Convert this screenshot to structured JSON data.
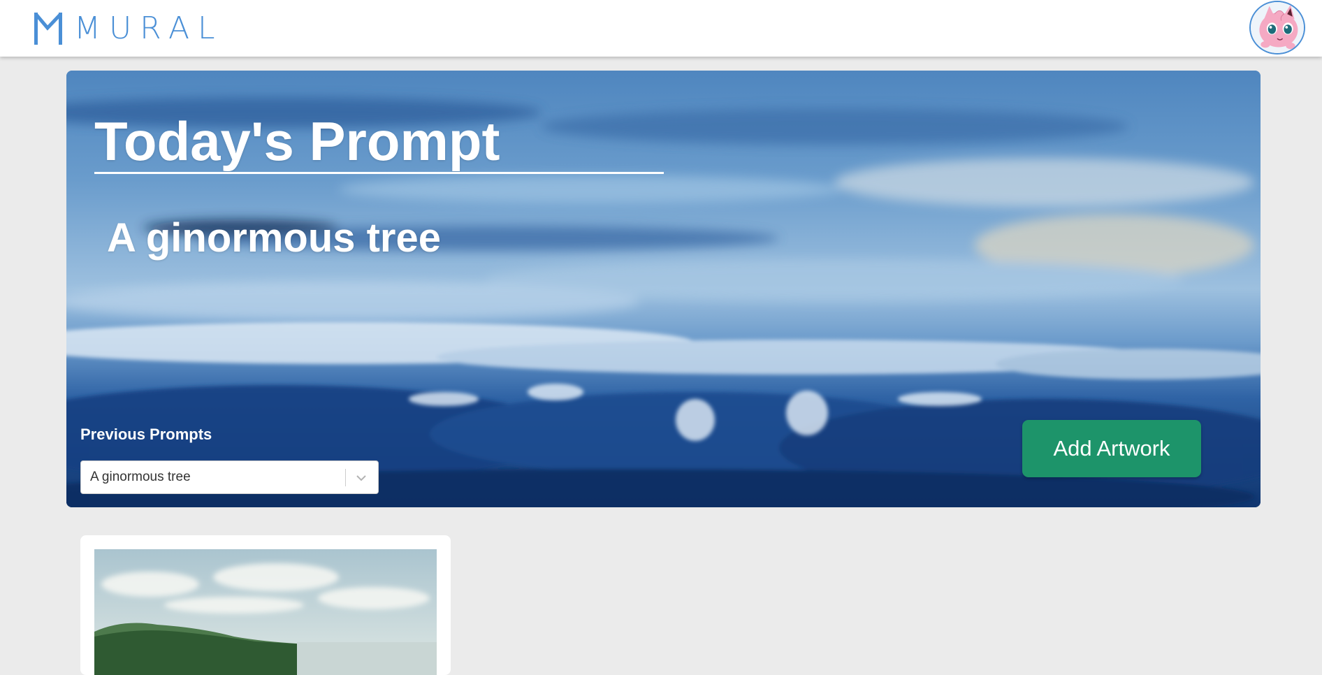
{
  "header": {
    "logo_text": "MURAL",
    "logo_icon": "mural-logo-icon",
    "avatar_icon": "user-avatar-icon"
  },
  "hero": {
    "title": "Today's Prompt",
    "prompt": "A ginormous tree",
    "previous_label": "Previous Prompts",
    "previous_selected": "A ginormous tree",
    "add_button": "Add Artwork"
  },
  "gallery": {
    "cards": [
      {
        "image": "landscape-artwork-image"
      }
    ]
  },
  "colors": {
    "brand": "#4a8fd6",
    "accent_button": "#1d946a",
    "page_bg": "#ebebeb"
  }
}
